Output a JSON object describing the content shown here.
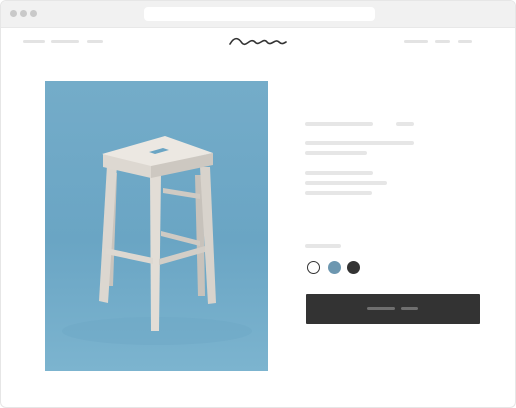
{
  "browser": {
    "window_controls": [
      "close",
      "minimize",
      "maximize"
    ],
    "address_bar": ""
  },
  "header": {
    "logo": "wave-logo",
    "nav_left": [
      "",
      "",
      ""
    ],
    "nav_right": [
      "",
      "",
      ""
    ]
  },
  "product": {
    "image": "wooden-bar-stool",
    "image_background": "#6aa5c4",
    "title": "",
    "price": "",
    "description": [
      "",
      ""
    ],
    "details": [
      "",
      "",
      ""
    ],
    "color_label": "",
    "colors": [
      {
        "name": "white",
        "hex": "#ffffff",
        "selected": true
      },
      {
        "name": "blue",
        "hex": "#6d97b0",
        "selected": false
      },
      {
        "name": "black",
        "hex": "#333333",
        "selected": false
      }
    ],
    "add_to_cart": "",
    "button_color": "#333333"
  }
}
